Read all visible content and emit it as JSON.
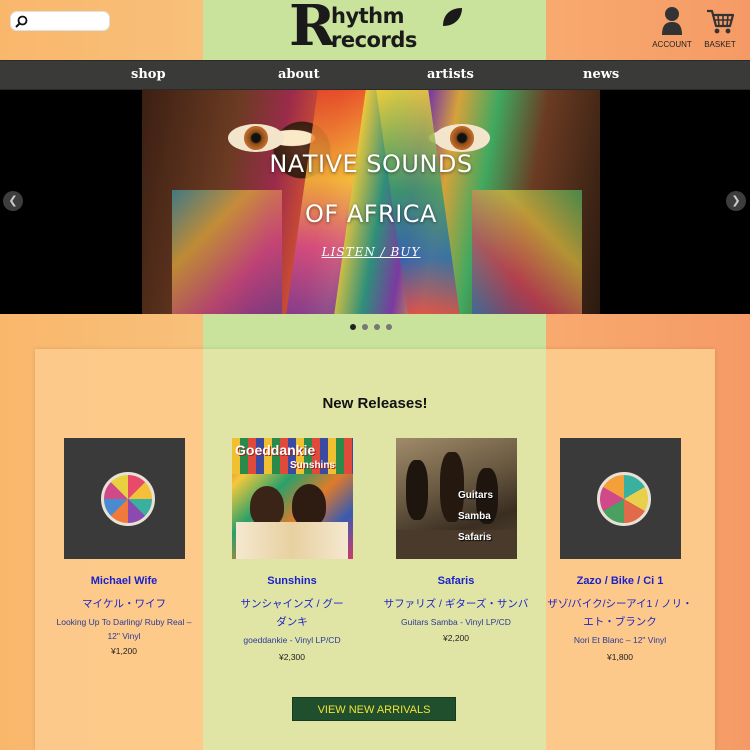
{
  "header": {
    "search": {
      "placeholder": "",
      "value": ""
    },
    "logo": {
      "letter": "R",
      "line1": "hythm",
      "line2": "records"
    },
    "account_label": "ACCOUNT",
    "basket_label": "BASKET"
  },
  "nav": {
    "items": [
      {
        "label": "shop"
      },
      {
        "label": "about"
      },
      {
        "label": "artists"
      },
      {
        "label": "news"
      }
    ]
  },
  "hero": {
    "title_line1": "NATIVE SOUNDS",
    "title_line2": "OF AFRICA",
    "link": "LISTEN / BUY",
    "prev": "❮",
    "next": "❯",
    "slides": 4,
    "active_slide": 1
  },
  "releases": {
    "title": "New Releases!",
    "products": [
      {
        "title": "Michael Wife",
        "title_jp": "マイケル・ワイフ",
        "subtitle": "Looking Up To Darling/ Ruby Real – 12\" Vinyl",
        "price": "¥1,200"
      },
      {
        "title": "Sunshins",
        "title_jp": "サンシャインズ / グーダンキ",
        "subtitle": "goeddankie - Vinyl LP/CD",
        "price": "¥2,300",
        "cover_text_top": "Goeddankie",
        "cover_text_mid": "Sunshins"
      },
      {
        "title": "Safaris",
        "title_jp": "サファリズ / ギターズ・サンバ",
        "subtitle": "Guitars Samba - Vinyl LP/CD",
        "price": "¥2,200",
        "cover_text": [
          "Guitars",
          "Samba",
          "Safaris"
        ]
      },
      {
        "title": "Zazo / Bike / Ci 1",
        "title_jp": "ザゾ/バイク/シーアイ1 / ノリ・エト・ブランク",
        "subtitle": "Nori Et Blanc – 12\" Vinyl",
        "price": "¥1,800"
      }
    ],
    "button": "VIEW NEW ARRIVALS"
  },
  "colors": {
    "nav_bg": "#3a3b38",
    "link_blue": "#1a22c8",
    "button_bg": "#1f4f2c",
    "button_text": "#f4e23a",
    "side_orange": "#f8c07a",
    "center_green": "#c9e39d"
  }
}
